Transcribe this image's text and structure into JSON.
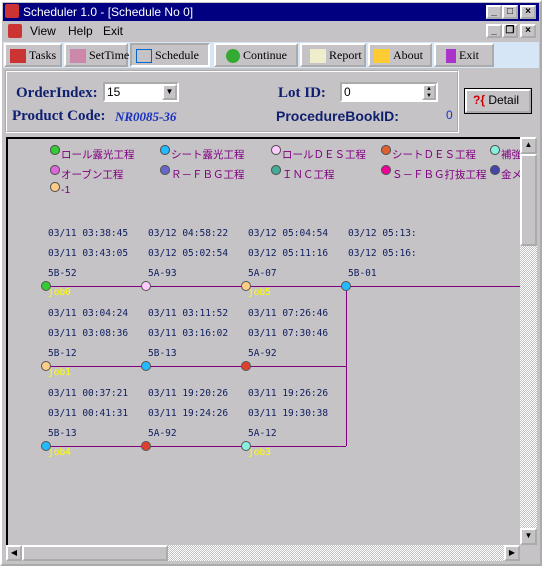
{
  "window": {
    "title": "Scheduler 1.0 - [Schedule No 0]"
  },
  "menu": [
    "View",
    "Help",
    "Exit"
  ],
  "toolbar": [
    "Tasks",
    "SetTime",
    "Schedule",
    "Continue",
    "Report",
    "About",
    "Exit"
  ],
  "form": {
    "order_index_label": "OrderIndex:",
    "order_index_value": "15",
    "lot_id_label": "Lot ID:",
    "lot_id_value": "0",
    "product_code_label": "Product Code:",
    "product_code_value": "NR0085-36",
    "procedure_book_label": "ProcedureBookID:",
    "procedure_book_value": "0",
    "detail_label": "Detail"
  },
  "legend": [
    {
      "label": "ロール露光工程",
      "color": "#33cc33"
    },
    {
      "label": "シート露光工程",
      "color": "#22bbff"
    },
    {
      "label": "ロールＤＥＳ工程",
      "color": "#ffccff"
    },
    {
      "label": "シートＤＥＳ工程",
      "color": "#e06030"
    },
    {
      "label": "補強",
      "color": "#88eedd"
    },
    {
      "label": "オーブン工程",
      "color": "#dd66dd"
    },
    {
      "label": "Ｒ－ＦＢＧ工程",
      "color": "#6666cc"
    },
    {
      "label": "ＩＮＣ工程",
      "color": "#44aa99"
    },
    {
      "label": "Ｓ－ＦＢＧ打抜工程",
      "color": "#ee0099"
    },
    {
      "label": "金メ",
      "color": "#4444aa"
    },
    {
      "label": "-1",
      "color": "#ffcc88"
    }
  ],
  "jobs": [
    {
      "name": "job0",
      "label_node": 0,
      "nodes": [
        {
          "start": "03/11 03:38:45",
          "end": "03/11 03:43:05",
          "machine": "5B-52",
          "color": "#33cc33"
        },
        {
          "start": "03/12 04:58:22",
          "end": "03/12 05:02:54",
          "machine": "5A-93",
          "color": "#ffccff"
        },
        {
          "start": "03/12 05:04:54",
          "end": "03/12 05:11:16",
          "machine": "5A-07",
          "color": "#ffcc88",
          "job": "job5"
        },
        {
          "start": "03/12 05:13:",
          "end": "03/12 05:16:",
          "machine": "5B-01",
          "color": "#22bbff"
        }
      ]
    },
    {
      "name": "job1",
      "nodes": [
        {
          "start": "03/11 03:04:24",
          "end": "03/11 03:08:36",
          "machine": "5B-12",
          "color": "#ffcc88"
        },
        {
          "start": "03/11 03:11:52",
          "end": "03/11 03:16:02",
          "machine": "5B-13",
          "color": "#22bbff"
        },
        {
          "start": "03/11 07:26:46",
          "end": "03/11 07:30:46",
          "machine": "5A-92",
          "color": "#e04030"
        }
      ]
    },
    {
      "name": "job4",
      "nodes": [
        {
          "start": "03/11 00:37:21",
          "end": "03/11 00:41:31",
          "machine": "5B-13",
          "color": "#22bbff"
        },
        {
          "start": "03/11 19:20:26",
          "end": "03/11 19:24:26",
          "machine": "5A-92",
          "color": "#e04030"
        },
        {
          "start": "03/11 19:26:26",
          "end": "03/11 19:30:38",
          "machine": "5A-12",
          "color": "#88eedd",
          "job": "job3"
        }
      ]
    }
  ],
  "colors": {
    "title_bar": "#000080",
    "line": "#800080",
    "job_label": "#ffff00"
  }
}
